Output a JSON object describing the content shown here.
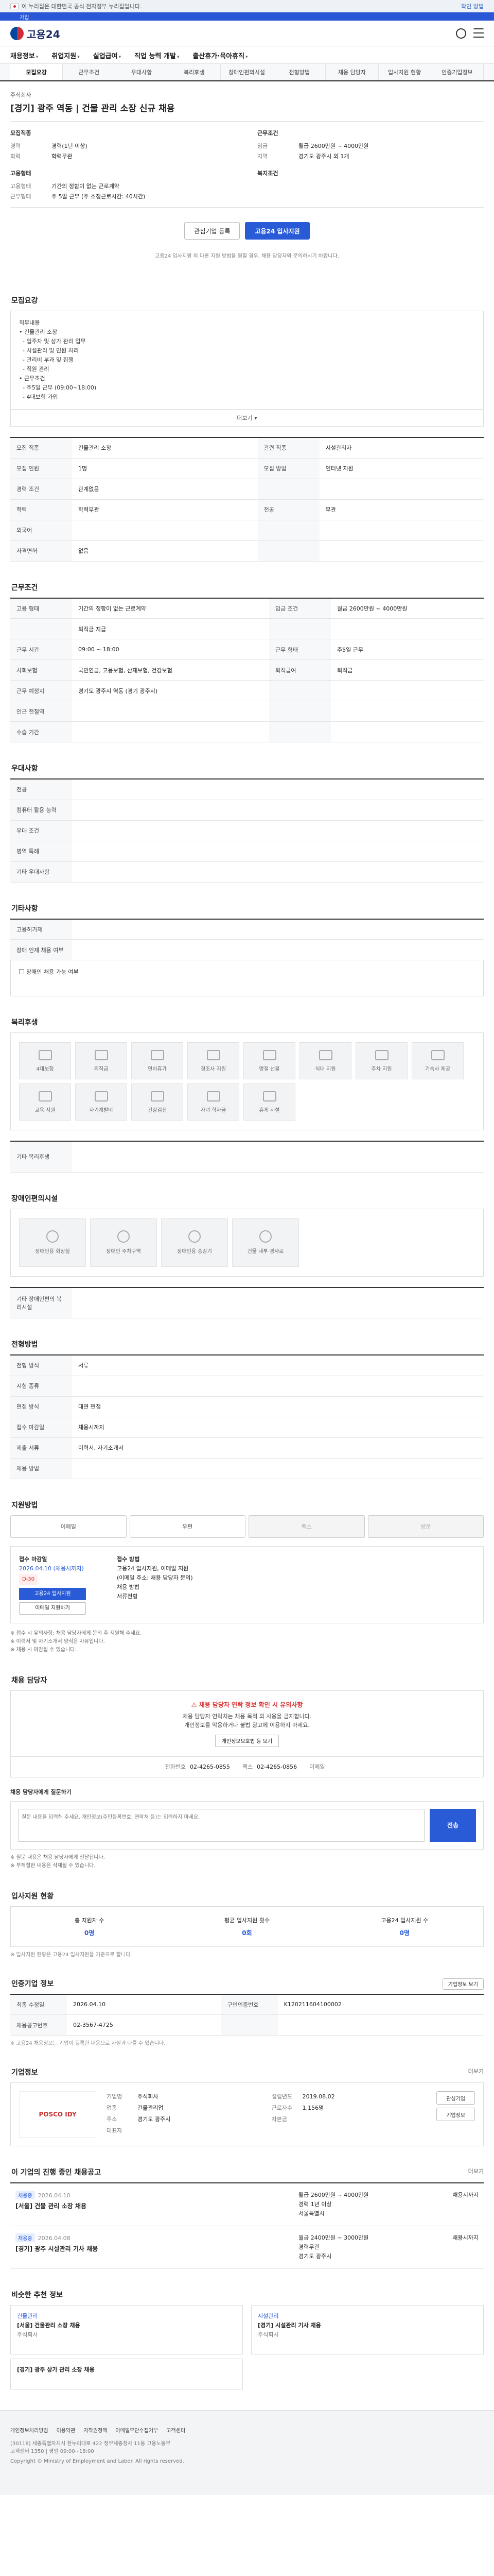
{
  "util": {
    "notice": "이 누리집은 대한민국 공식 전자정부 누리집입니다.",
    "toggle": "확인 방법"
  },
  "strip": {
    "items": [
      "",
      "가입"
    ]
  },
  "brand": {
    "logo_text": "고용24"
  },
  "gnb": [
    "채용정보",
    "취업지원",
    "실업급여",
    "직업 능력 개발",
    "출산휴가·육아휴직"
  ],
  "tabs": [
    "모집요강",
    "근무조건",
    "우대사항",
    "복리후생",
    "장애인편의시설",
    "전형방법",
    "채용 담당자",
    "입사지원 현황",
    "인증기업정보"
  ],
  "job": {
    "company": "주식회사",
    "title": "[경기] 광주 역동 | 건물 관리 소장 신규 채용"
  },
  "summary": {
    "left_head": "모집직종",
    "right_head": "근무조건",
    "left": [
      [
        "경력",
        "경력(1년 이상)"
      ],
      [
        "학력",
        "학력무관"
      ],
      [
        "",
        ""
      ]
    ],
    "right": [
      [
        "임금",
        "월급 2600만원 ~ 4000만원"
      ],
      [
        "지역",
        "경기도 광주시 외 1개"
      ],
      [
        "",
        ""
      ]
    ],
    "left2_head": "고용형태",
    "right2_head": "복지조건",
    "left2": [
      [
        "고용형태",
        "기간의 정함이 없는 근로계약"
      ],
      [
        "근무형태",
        "주 5일 근무 (주 소정근로시간: 40시간)"
      ]
    ]
  },
  "buttons": {
    "interest": "관심기업 등록",
    "apply": "고용24 입사지원"
  },
  "notice_small": "고용24 입사지원 외 다른 지원 방법을 원할 경우, 채용 담당자와 문의하시기 바랍니다.",
  "recruit": {
    "title": "모집요강",
    "desc_lines": [
      "직무내용",
      "• 건물관리 소장",
      "  - 입주자 및 상가 관리 업무",
      "  - 시설관리 및 민원 처리",
      "  - 관리비 부과 및 집행",
      "  - 직원 관리",
      "• 근무조건",
      "  - 주5일 근무 (09:00~18:00)",
      "  - 4대보험 가입"
    ],
    "more": "더보기",
    "rows": [
      [
        "모집 직종",
        "건물관리 소장",
        "관련 직종",
        "시설관리자"
      ],
      [
        "모집 인원",
        "1명",
        "모집 방법",
        "인터넷 지원"
      ],
      [
        "경력 조건",
        "관계없음",
        "",
        ""
      ],
      [
        "학력",
        "학력무관",
        "전공",
        "무관"
      ],
      [
        "외국어",
        "",
        "",
        ""
      ],
      [
        "자격면허",
        "없음",
        "",
        ""
      ]
    ]
  },
  "work": {
    "title": "근무조건",
    "rows": [
      [
        "고용 형태",
        "기간의 정함이 없는 근로계약",
        "임금 조건",
        "월급 2600만원 ~ 4000만원"
      ],
      [
        "",
        "퇴직금 지급",
        "",
        ""
      ],
      [
        "근무 시간",
        "09:00 ~ 18:00",
        "근무 형태",
        "주5일 근무"
      ],
      [
        "사회보험",
        "국민연금, 고용보험, 산재보험, 건강보험",
        "퇴직급여",
        "퇴직금"
      ],
      [
        "근무 예정지",
        "경기도 광주시 역동 (경기 광주시)",
        "",
        ""
      ],
      [
        "인근 전철역",
        "",
        "",
        ""
      ],
      [
        "수습 기간",
        "",
        "",
        " "
      ]
    ],
    "map_btn": "지도 보기"
  },
  "prefer": {
    "title": "우대사항",
    "rows": [
      [
        "전공",
        ""
      ],
      [
        "컴퓨터 활용 능력",
        ""
      ],
      [
        "우대 조건",
        ""
      ],
      [
        "병역 특례",
        ""
      ],
      [
        "기타 우대사항",
        ""
      ]
    ]
  },
  "etc": {
    "title": "기타사항",
    "rows": [
      [
        "고용허가제",
        ""
      ],
      [
        "장애 인재 채용 여부",
        ""
      ]
    ],
    "note": "장애인 채용 가능 여부"
  },
  "welfare": {
    "title": "복리후생",
    "items": [
      "4대보험",
      "퇴직금",
      "연차휴가",
      "경조사 지원",
      "명절 선물",
      "식대 지원",
      "주차 지원",
      "기숙사 제공",
      "교육 지원",
      "자기계발비",
      "건강검진",
      "자녀 학자금",
      "휴게 시설"
    ]
  },
  "welfare_text": {
    "label": "기타 복리후생",
    "val": ""
  },
  "facility": {
    "title": "장애인편의시설",
    "items": [
      "장애인용 화장실",
      "장애인 주차구역",
      "장애인용 승강기",
      "건물 내부 경사로"
    ],
    "etc_label": "기타 장애인편의 복리시설",
    "etc_val": ""
  },
  "method": {
    "title": "전형방법",
    "rows": [
      [
        "전형 방식",
        "서류"
      ],
      [
        "시험 종류",
        ""
      ],
      [
        "면접 방식",
        "대면 면접"
      ],
      [
        "접수 마감일",
        "채용시까지"
      ]
    ],
    "rows2": [
      [
        "제출 서류",
        "이력서, 자기소개서"
      ],
      [
        "채용 방법",
        ""
      ]
    ]
  },
  "apply_method": {
    "title": "지원방법",
    "opts": [
      "이메일",
      "우편",
      "팩스",
      "방문"
    ],
    "left_head": "접수 마감일",
    "deadline": "2026.04.10 (채용시까지)",
    "pill": "D-30",
    "btn1": "고용24 입사지원",
    "btn2": "이메일 지원하기",
    "right_head": "접수 방법",
    "right_lines": [
      "고용24 입사지원, 이메일 지원",
      "(이메일 주소: 채용 담당자 문의)",
      "채용 방법",
      "서류전형"
    ],
    "bullets": [
      "※ 접수 시 유의사항: 채용 담당자에게 문의 후 지원해 주세요.",
      "※ 이력서 및 자기소개서 양식은 자유입니다.",
      "※ 채용 시 마감될 수 있습니다."
    ]
  },
  "contact": {
    "title": "채용 담당자",
    "alert_head": "채용 담당자 연락 정보 확인 시 유의사항",
    "alert_body": [
      "채용 담당자 연락처는 채용 목적 외 사용을 금지합니다.",
      "개인정보를 악용하거나 불법 광고에 이용하지 마세요."
    ],
    "alert_btn": "개인정보보호법 등 보기",
    "items": [
      [
        "전화번호",
        "02-4265-0855"
      ],
      [
        "팩스",
        "02-4265-0856"
      ],
      [
        "이메일",
        ""
      ]
    ],
    "qa_head": "채용 담당자에게 질문하기",
    "qa_placeholder": "질문 내용을 입력해 주세요. 개인정보(주민등록번호, 연락처 등)는 입력하지 마세요.",
    "qa_send": "전송",
    "qa_foot": [
      "※ 질문 내용은 채용 담당자에게 전달됩니다.",
      "※ 부적절한 내용은 삭제될 수 있습니다."
    ]
  },
  "status": {
    "title": "입사지원 현황",
    "stats": [
      [
        "총 지원자 수",
        "0명"
      ],
      [
        "평균 입사지원 횟수",
        "0회"
      ],
      [
        "고용24 입사지원 수",
        "0명"
      ]
    ],
    "note": "※ 입사지원 현황은 고용24 입사지원을 기준으로 합니다."
  },
  "meta": {
    "title": "인증기업 정보",
    "btn": "기업정보 보기",
    "rows": [
      [
        "최종 수정일",
        "2026.04.10",
        "구인인증번호",
        "K120211604100002"
      ],
      [
        "채용공고번호",
        "02-3567-4725",
        "",
        ""
      ]
    ],
    "note": "※ 고용24 채용정보는 기업이 등록한 내용으로 사실과 다를 수 있습니다."
  },
  "corp": {
    "title": "기업정보",
    "more": "더보기",
    "logo": "POSCO IDY",
    "rows": [
      [
        "기업명",
        "주식회사"
      ],
      [
        "업종",
        "건물관리업"
      ],
      [
        "주소",
        "경기도 광주시"
      ],
      [
        "대표자",
        ""
      ]
    ],
    "rows2": [
      [
        "설립년도",
        "2019.08.02"
      ],
      [
        "근로자수",
        "1,156명"
      ],
      [
        "자본금",
        ""
      ]
    ],
    "btns": [
      "관심기업",
      "기업정보"
    ]
  },
  "others": {
    "title": "이 기업의 진행 중인 채용공고",
    "more": "더보기",
    "items": [
      {
        "badge": "채용중",
        "date": "2026.04.10",
        "title": "[서울] 건물 관리 소장 채용",
        "salary": "월급 2600만원 ~ 4000만원",
        "career": "경력 1년 이상",
        "loc": "서울특별시",
        "end": "채용시까지"
      },
      {
        "badge": "채용중",
        "date": "2026.04.08",
        "title": "[경기] 광주 시설관리 기사 채용",
        "salary": "월급 2400만원 ~ 3000만원",
        "career": "경력무관",
        "loc": "경기도 광주시",
        "end": "채용시까지"
      }
    ]
  },
  "recom": {
    "title": "비슷한 추천 정보",
    "cards": [
      {
        "head": "건물관리",
        "title": "[서울] 건물관리 소장 채용",
        "sub": "주식회사"
      },
      {
        "head": "시설관리",
        "title": "[경기] 시설관리 기사 채용",
        "sub": "주식회사"
      }
    ],
    "third": "[경기] 광주 상가 관리 소장 채용"
  },
  "footer": {
    "links": [
      "개인정보처리방침",
      "이용약관",
      "저작권정책",
      "이메일무단수집거부",
      "고객센터"
    ],
    "line1": "(30118) 세종특별자치시 한누리대로 422 정부세종청사 11동 고용노동부",
    "line2": "고객센터 1350 | 평일 09:00~18:00",
    "copy": "Copyright © Ministry of Employment and Labor. All rights reserved."
  },
  "colors": {
    "primary": "#2a5bd7",
    "alert": "#d93838"
  }
}
